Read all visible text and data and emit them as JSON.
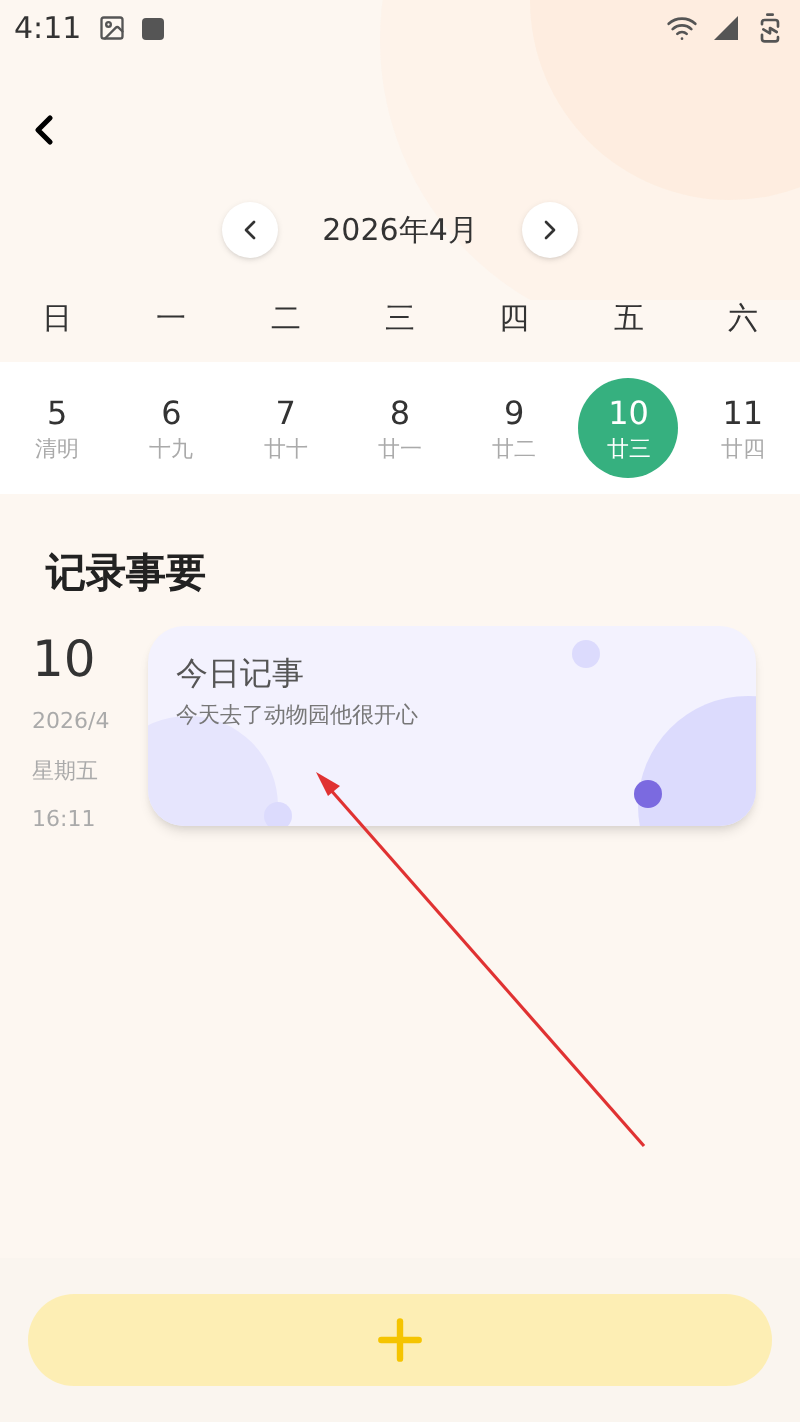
{
  "status_bar": {
    "time": "4:11"
  },
  "month_nav": {
    "title": "2026年4月"
  },
  "weekdays": [
    "日",
    "一",
    "二",
    "三",
    "四",
    "五",
    "六"
  ],
  "days": [
    {
      "day": "5",
      "lunar": "清明",
      "selected": false
    },
    {
      "day": "6",
      "lunar": "十九",
      "selected": false
    },
    {
      "day": "7",
      "lunar": "廿十",
      "selected": false
    },
    {
      "day": "8",
      "lunar": "廿一",
      "selected": false
    },
    {
      "day": "9",
      "lunar": "廿二",
      "selected": false
    },
    {
      "day": "10",
      "lunar": "廿三",
      "selected": true
    },
    {
      "day": "11",
      "lunar": "廿四",
      "selected": false
    }
  ],
  "section_title": "记录事要",
  "records": [
    {
      "day": "10",
      "date": "2026/4",
      "weekday": "星期五",
      "time": "16:11",
      "title": "今日记事",
      "body": "今天去了动物园他很开心"
    }
  ]
}
